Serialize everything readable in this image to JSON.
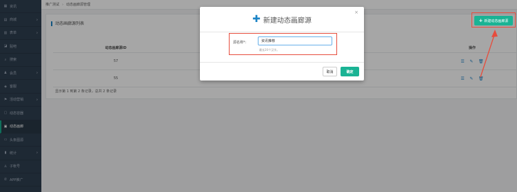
{
  "sidebar": {
    "items": [
      {
        "icon": "▦",
        "label": "资讯",
        "chevron": false
      },
      {
        "icon": "▤",
        "label": "商城",
        "chevron": true
      },
      {
        "icon": "▥",
        "label": "表单",
        "chevron": true
      },
      {
        "icon": "◪",
        "label": "贴吧",
        "chevron": false
      },
      {
        "icon": "⌕",
        "label": "搜索",
        "chevron": false
      },
      {
        "icon": "♟",
        "label": "会员",
        "chevron": true
      },
      {
        "icon": "◈",
        "label": "客服",
        "chevron": false
      },
      {
        "icon": "⚑",
        "label": "活动营销",
        "chevron": true
      },
      {
        "icon": "▢",
        "label": "动态容器",
        "chevron": false
      },
      {
        "icon": "▣",
        "label": "动态画廊",
        "chevron": false,
        "active": true
      },
      {
        "icon": "▭",
        "label": "头条图源",
        "chevron": false
      },
      {
        "icon": "▮",
        "label": "统计",
        "chevron": true
      },
      {
        "icon": "♙",
        "label": "子帐号",
        "chevron": false
      },
      {
        "icon": "✆",
        "label": "APP推广",
        "chevron": false
      }
    ]
  },
  "breadcrumb": {
    "root": "推广测试",
    "current": "动态画廊源管理"
  },
  "panel": {
    "title": "动态画廊源列表"
  },
  "add_button": {
    "label": "新建动态画廊源"
  },
  "table": {
    "headers": [
      "动态画廊源ID",
      "",
      "操作"
    ],
    "rows": [
      {
        "id": "57"
      },
      {
        "id": "55"
      }
    ]
  },
  "pager": {
    "info": "显示第 1 到第 2 条记录，总共 2 条记录"
  },
  "modal": {
    "title": "新建动态画廊源",
    "close": "×",
    "field_label": "源名称*:",
    "field_value": "资讯推荐",
    "field_hint": "最长20个汉字。",
    "cancel": "取消",
    "ok": "确定"
  },
  "colors": {
    "accent": "#1ab394",
    "highlight": "#e74c3c",
    "sidebar": "#2f4050"
  }
}
